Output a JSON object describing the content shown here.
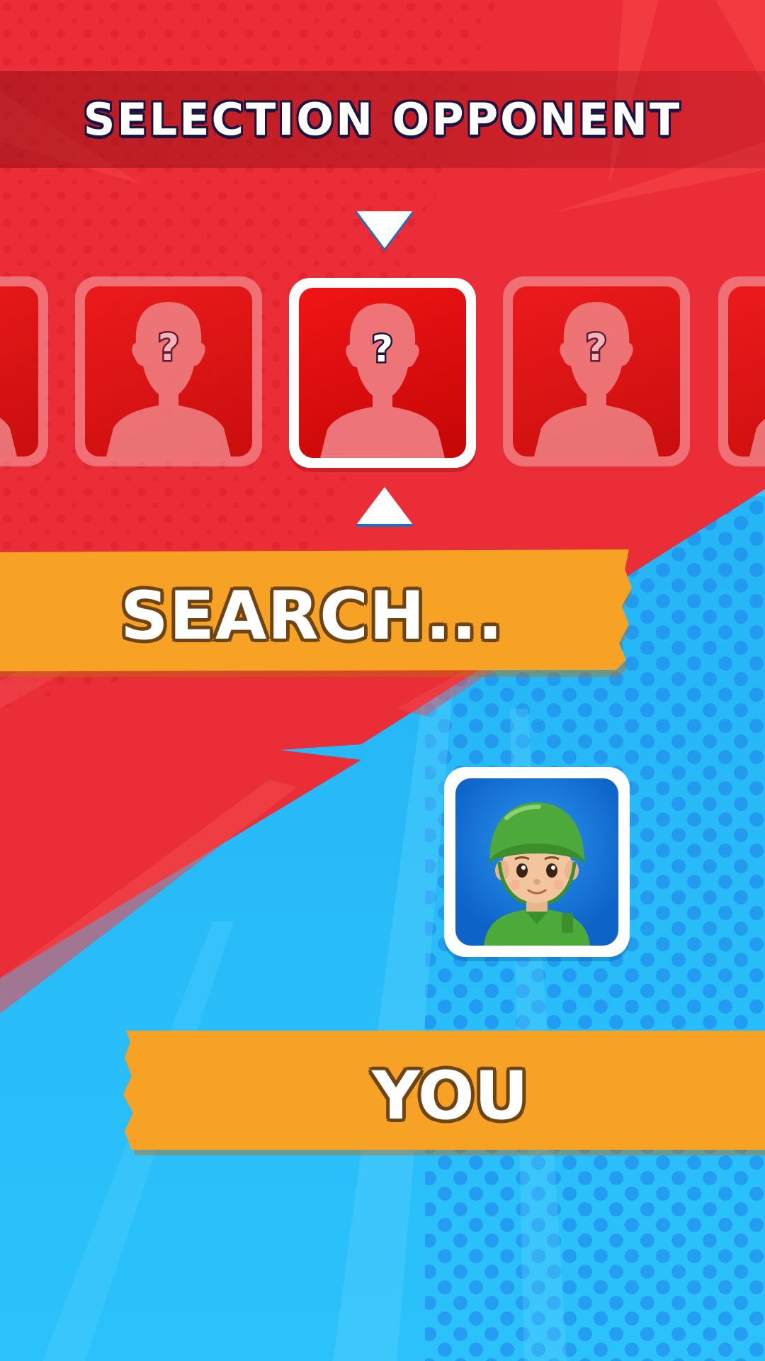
{
  "header": {
    "title": "SELECTION OPPONENT"
  },
  "opponent_carousel": {
    "slots": [
      {
        "label": "?",
        "state": "dimmed"
      },
      {
        "label": "?",
        "state": "dimmed"
      },
      {
        "label": "?",
        "state": "selected"
      },
      {
        "label": "?",
        "state": "dimmed"
      },
      {
        "label": "?",
        "state": "dimmed"
      }
    ]
  },
  "status": {
    "label": "SEARCH..."
  },
  "player": {
    "label": "YOU",
    "avatar_icon": "toy-soldier-avatar-icon"
  },
  "colors": {
    "red_side": "#ea2d36",
    "blue_side": "#25b6f5",
    "banner_orange": "#f7a225",
    "banner_outline": "#6e4413",
    "title_outline": "#1b1340"
  }
}
